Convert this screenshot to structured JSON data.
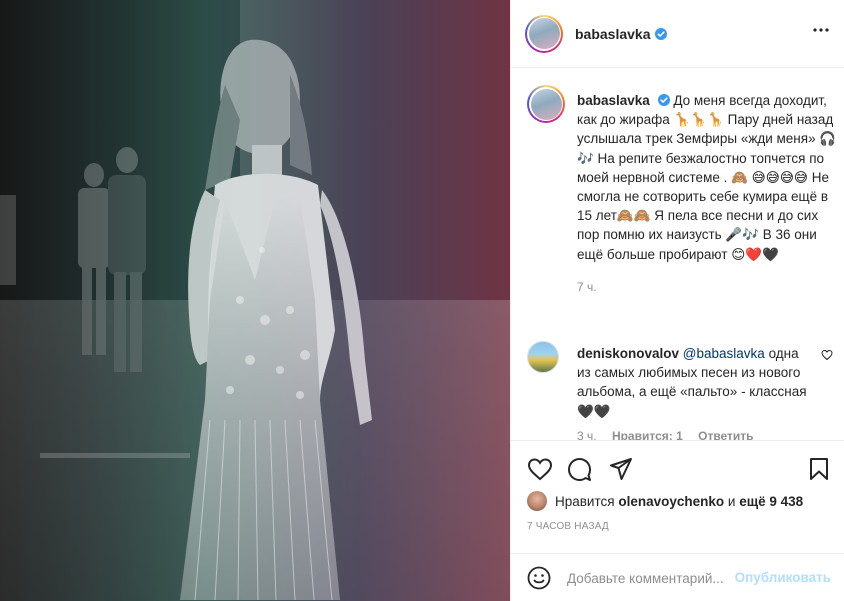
{
  "post": {
    "username": "babaslavka",
    "verified": true,
    "more_icon": "more-options-icon"
  },
  "caption": {
    "username": "babaslavka",
    "text": "До меня всегда доходит, как до жирафа 🦒🦒🦒 Пару дней назад услышала трек Земфиры «жди меня» 🎧🎶 На репите безжалостно топчется по моей нервной системе . 🙈 😅😅😅😅 Не смогла не сотворить себе кумира ещё в 15 лет🙈🙈 Я пела все песни и до сих пор помню их наизусть 🎤🎶 В 36 они ещё больше пробирают 😊❤️🖤",
    "time": "7 ч."
  },
  "comment": {
    "username": "deniskonovalov",
    "mention": "@babaslavka",
    "text": "одна из самых любимых песен из нового альбома, а ещё «пальто» - классная 🖤🖤",
    "time": "3 ч.",
    "likes": "Нравится: 1",
    "reply": "Ответить"
  },
  "likes": {
    "prefix": "Нравится",
    "user": "olenavoychenko",
    "joiner": "и",
    "others": "ещё 9 438"
  },
  "date": "7 ЧАСОВ НАЗАД",
  "add_comment": {
    "placeholder": "Добавьте комментарий...",
    "post_label": "Опубликовать"
  },
  "colors": {
    "verified": "#3897f0",
    "post_button": "#b2dffc",
    "secondary_text": "#8e8e8e",
    "border": "#efefef"
  }
}
